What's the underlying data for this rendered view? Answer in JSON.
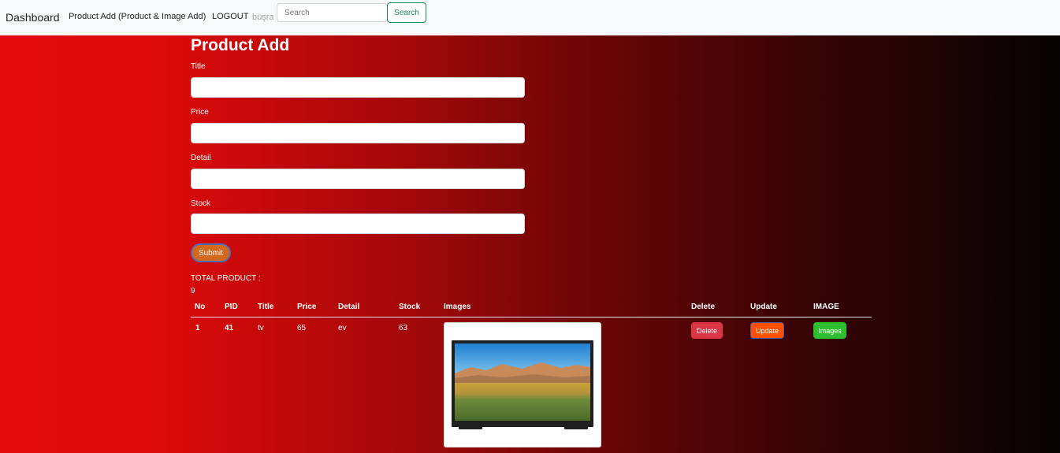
{
  "navbar": {
    "brand": "Dashboard",
    "links": [
      "Product Add (Product & Image Add)",
      "LOGOUT"
    ],
    "user": "büşra",
    "search_placeholder": "Search",
    "search_button": "Search"
  },
  "form": {
    "title": "Product Add",
    "fields": [
      {
        "label": "Title",
        "value": ""
      },
      {
        "label": "Price",
        "value": ""
      },
      {
        "label": "Detail",
        "value": ""
      },
      {
        "label": "Stock",
        "value": ""
      }
    ],
    "submit_label": "Submit"
  },
  "summary": {
    "total_label": "TOTAL PRODUCT :",
    "total_count": "9"
  },
  "table": {
    "headers": [
      "No",
      "PID",
      "Title",
      "Price",
      "Detail",
      "Stock",
      "Images",
      "Delete",
      "Update",
      "IMAGE"
    ],
    "rows": [
      {
        "no": "1",
        "pid": "41",
        "title": "tv",
        "price": "65",
        "detail": "ev",
        "stock": "63",
        "image_icon": "tv-image",
        "delete_label": "Delete",
        "update_label": "Update",
        "images_label": "Images"
      }
    ]
  },
  "colors": {
    "delete": "#dc3545",
    "update": "#ff4f00",
    "images": "#2fbe2f",
    "submit": "#d2691e"
  }
}
